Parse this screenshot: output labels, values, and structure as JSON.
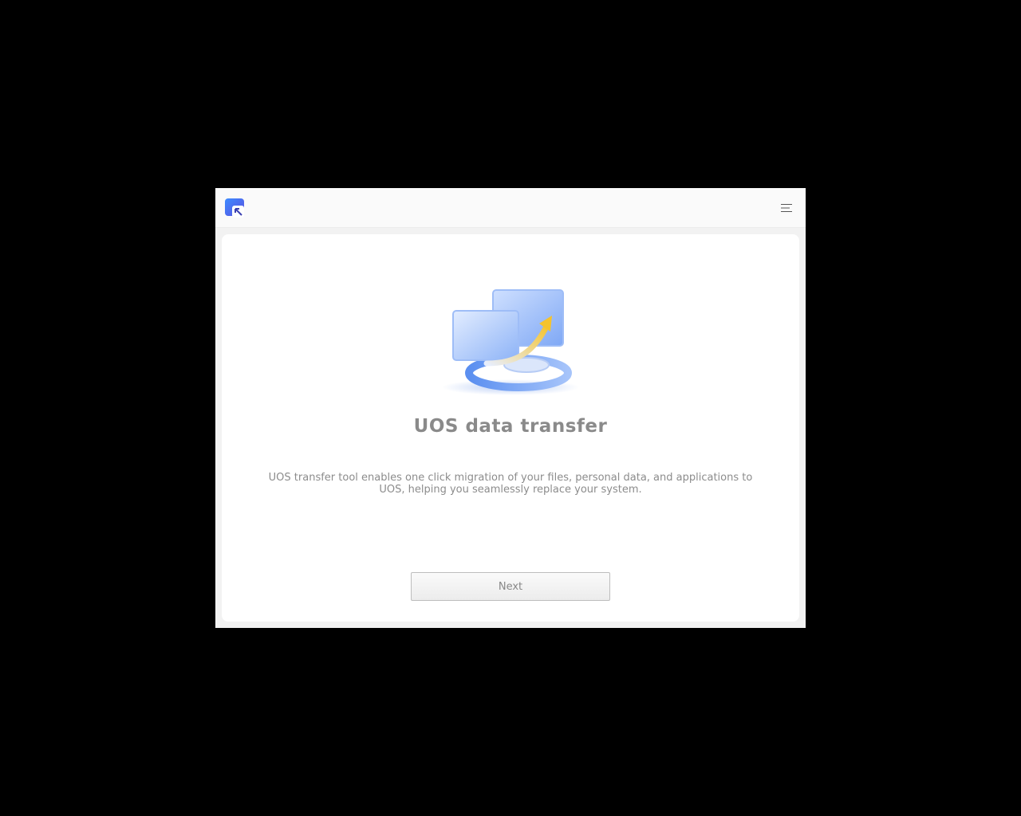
{
  "window": {
    "app_icon": "uos-transfer-app-icon",
    "menu_icon": "hamburger-menu-icon"
  },
  "main": {
    "illustration": "data-transfer-illustration",
    "title": "UOS data transfer",
    "description": "UOS transfer tool enables one click migration of your files, personal data, and applications to UOS, helping you seamlessly replace your system.",
    "next_label": "Next"
  },
  "colors": {
    "accent": "#2f7bf5",
    "arrow": "#f5c32c",
    "title_text": "#8a8a8a"
  }
}
